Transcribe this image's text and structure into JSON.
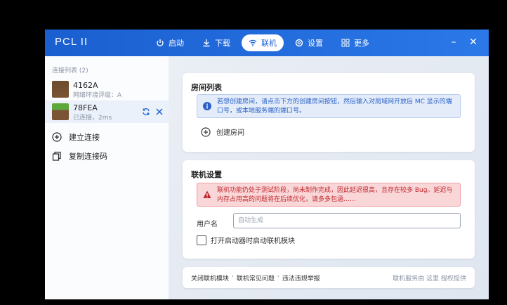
{
  "app": {
    "title": "PCL II"
  },
  "nav": [
    {
      "label": "启动",
      "icon": "power-icon"
    },
    {
      "label": "下载",
      "icon": "download-icon"
    },
    {
      "label": "联机",
      "icon": "wifi-icon",
      "active": true
    },
    {
      "label": "设置",
      "icon": "gear-icon"
    },
    {
      "label": "更多",
      "icon": "grid-icon"
    }
  ],
  "sidebar": {
    "section_label": "连接列表 (2)",
    "connections": [
      {
        "name": "4162A",
        "status": "网络环境评级：A"
      },
      {
        "name": "78FEA",
        "status": "已连接，2ms",
        "selected": true
      }
    ],
    "actions": [
      {
        "label": "建立连接",
        "icon": "plus-circle-icon"
      },
      {
        "label": "复制连接码",
        "icon": "copy-icon"
      }
    ]
  },
  "room_card": {
    "title": "房间列表",
    "info": "若想创建房间，请点击下方的创建房间按钮，然后输入对局域网开放后 MC 显示的端口号，或本地服务端的端口号。",
    "create_label": "创建房间"
  },
  "settings_card": {
    "title": "联机设置",
    "warning": "联机功能仍处于测试阶段，尚未制作完成，因此延迟很高，且存在较多 Bug。延迟与内存占用高的问题将在后续优化，请多多包涵……",
    "username_label": "用户名",
    "username_placeholder": "自动生成",
    "autostart_label": "打开启动器时启动联机模块"
  },
  "footer": {
    "links": [
      "关闭联机模块",
      "联机常见问题",
      "违法违规举报"
    ],
    "separator": "·",
    "credit": "联机服务由 这里 授权提供"
  },
  "colors": {
    "accent": "#1f62d6",
    "info_bg": "#e4ecfa",
    "warn_bg": "#f9d6d7",
    "warn_text": "#c0282e"
  }
}
